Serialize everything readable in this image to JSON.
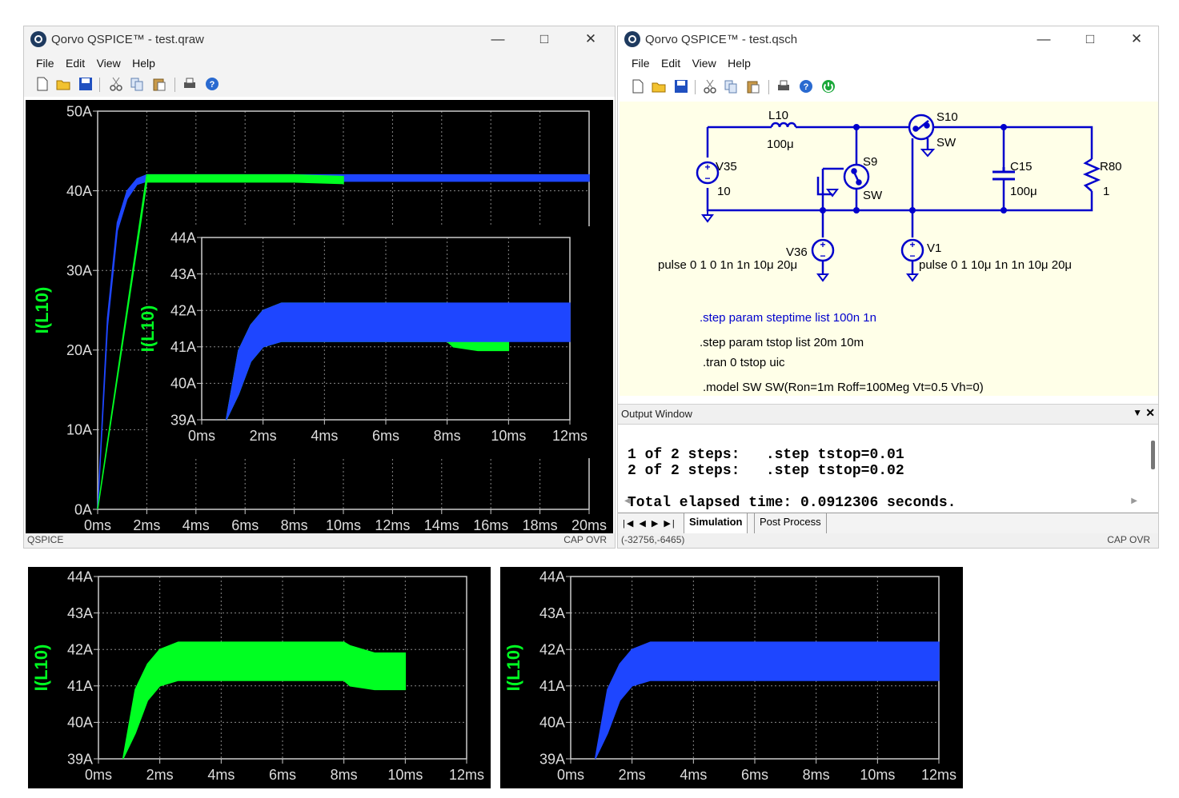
{
  "left_window": {
    "title": "Qorvo QSPICE™ - test.qraw",
    "menu": [
      "File",
      "Edit",
      "View",
      "Help"
    ],
    "status_left": "QSPICE",
    "status_right": "CAP OVR"
  },
  "right_window": {
    "title": "Qorvo QSPICE™ - test.qsch",
    "menu": [
      "File",
      "Edit",
      "View",
      "Help"
    ],
    "status_left": "(-32756,-6465)",
    "status_right": "CAP OVR"
  },
  "schematic": {
    "L10": {
      "name": "L10",
      "value": "100μ"
    },
    "S10": {
      "name": "S10",
      "model": "SW"
    },
    "S9": {
      "name": "S9",
      "model": "SW"
    },
    "V35": {
      "name": "V35",
      "value": "10"
    },
    "C15": {
      "name": "C15",
      "value": "100μ"
    },
    "R80": {
      "name": "R80",
      "value": "1"
    },
    "V36": {
      "name": "V36",
      "value": "pulse 0 1 0 1n 1n 10μ 20μ"
    },
    "V1": {
      "name": "V1",
      "value": "pulse 0 1 10μ 1n 1n 10μ 20μ"
    },
    "directives": [
      ".step param steptime list 100n 1n",
      ".step param tstop list 20m 10m",
      ".tran 0 tstop uic",
      ".model SW SW(Ron=1m Roff=100Meg Vt=0.5 Vh=0)"
    ],
    "colors": {
      "wire": "#0000cc",
      "highlight_directive": "#0000cc",
      "text": "#000000",
      "background": "#ffffe8"
    }
  },
  "output_window": {
    "title": "Output Window",
    "lines": [
      "1 of 2 steps:   .step tstop=0.01",
      "2 of 2 steps:   .step tstop=0.02",
      "",
      "Total elapsed time: 0.0912306 seconds."
    ],
    "tabs": [
      "Simulation",
      "Post Process"
    ],
    "nav": [
      "|◀",
      "◀",
      "▶",
      "▶|"
    ]
  },
  "chart_data": [
    {
      "type": "area",
      "ylabel": "I(L10)",
      "xlabel": "",
      "x_ticks": [
        "0ms",
        "2ms",
        "4ms",
        "6ms",
        "8ms",
        "10ms",
        "12ms",
        "14ms",
        "16ms",
        "18ms",
        "20ms"
      ],
      "y_ticks": [
        "0A",
        "10A",
        "20A",
        "30A",
        "40A",
        "50A"
      ],
      "xlim": [
        0,
        20
      ],
      "ylim": [
        0,
        50
      ],
      "series": [
        {
          "color": "#1e46ff",
          "x_ms": [
            0,
            0.4,
            0.8,
            1.2,
            1.6,
            2,
            20
          ],
          "upper": [
            0,
            24,
            36,
            40,
            41.5,
            42,
            42
          ],
          "lower": [
            0,
            23,
            35,
            39,
            40.8,
            41.2,
            41.2
          ]
        },
        {
          "color": "#00ff22",
          "x_ms": [
            0,
            2,
            8,
            10
          ],
          "upper": [
            0,
            42,
            42,
            41.8
          ],
          "lower": [
            0,
            41.1,
            41.1,
            40.9
          ]
        }
      ]
    },
    {
      "type": "area",
      "ylabel": "I(L10)",
      "x_ticks": [
        "0ms",
        "2ms",
        "4ms",
        "6ms",
        "8ms",
        "10ms",
        "12ms"
      ],
      "y_ticks": [
        "39A",
        "40A",
        "41A",
        "42A",
        "43A",
        "44A"
      ],
      "xlim": [
        0,
        12
      ],
      "ylim": [
        39,
        44
      ],
      "series": [
        {
          "color": "#00ff22",
          "x_ms": [
            0.8,
            1.2,
            1.6,
            2,
            2.6,
            8,
            8.2,
            9,
            10
          ],
          "upper": [
            39,
            40.9,
            41.6,
            42,
            42.2,
            42.2,
            42.1,
            41.9,
            41.9
          ],
          "lower": [
            39,
            39.7,
            40.6,
            41,
            41.15,
            41.15,
            41.0,
            40.9,
            40.9
          ]
        },
        {
          "color": "#1e46ff",
          "x_ms": [
            0.8,
            1.2,
            1.6,
            2,
            2.6,
            12
          ],
          "upper": [
            39,
            40.9,
            41.6,
            42,
            42.2,
            42.2
          ],
          "lower": [
            39,
            39.7,
            40.6,
            41,
            41.15,
            41.15
          ]
        }
      ]
    },
    {
      "type": "area",
      "ylabel": "I(L10)",
      "x_ticks": [
        "0ms",
        "2ms",
        "4ms",
        "6ms",
        "8ms",
        "10ms",
        "12ms"
      ],
      "y_ticks": [
        "39A",
        "40A",
        "41A",
        "42A",
        "43A",
        "44A"
      ],
      "xlim": [
        0,
        12
      ],
      "ylim": [
        39,
        44
      ],
      "series": [
        {
          "color": "#00ff22",
          "x_ms": [
            0.8,
            1.2,
            1.6,
            2,
            2.6,
            8,
            8.2,
            9,
            10
          ],
          "upper": [
            39,
            40.9,
            41.6,
            42,
            42.2,
            42.2,
            42.1,
            41.9,
            41.9
          ],
          "lower": [
            39,
            39.7,
            40.6,
            41,
            41.15,
            41.15,
            41.0,
            40.9,
            40.9
          ]
        }
      ]
    },
    {
      "type": "area",
      "ylabel": "I(L10)",
      "x_ticks": [
        "0ms",
        "2ms",
        "4ms",
        "6ms",
        "8ms",
        "10ms",
        "12ms"
      ],
      "y_ticks": [
        "39A",
        "40A",
        "41A",
        "42A",
        "43A",
        "44A"
      ],
      "xlim": [
        0,
        12
      ],
      "ylim": [
        39,
        44
      ],
      "series": [
        {
          "color": "#1e46ff",
          "x_ms": [
            0.8,
            1.2,
            1.6,
            2,
            2.6,
            12
          ],
          "upper": [
            39,
            40.9,
            41.6,
            42,
            42.2,
            42.2
          ],
          "lower": [
            39,
            39.7,
            40.6,
            41,
            41.15,
            41.15
          ]
        }
      ]
    }
  ]
}
